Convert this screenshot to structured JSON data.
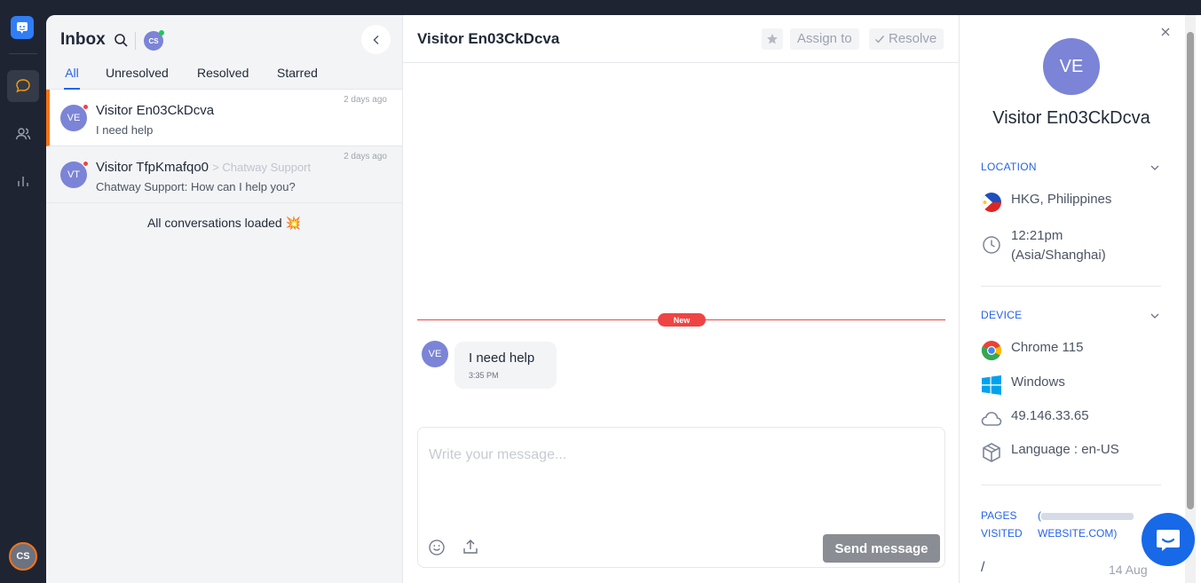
{
  "rail": {
    "user_initials": "CS"
  },
  "inbox": {
    "title": "Inbox",
    "agent_initials": "CS",
    "tabs": [
      {
        "label": "All"
      },
      {
        "label": "Unresolved"
      },
      {
        "label": "Resolved"
      },
      {
        "label": "Starred"
      }
    ],
    "conversations": [
      {
        "initials": "VE",
        "name": "Visitor En03CkDcva",
        "via": "",
        "preview": "I need help",
        "time": "2 days ago"
      },
      {
        "initials": "VT",
        "name": "Visitor TfpKmafqo0",
        "via": "> Chatway Support",
        "preview": "Chatway Support: How can I help you?",
        "time": "2 days ago"
      }
    ],
    "loaded_text": "All conversations loaded 💥"
  },
  "chat": {
    "title": "Visitor En03CkDcva",
    "assign_label": "Assign to",
    "resolve_label": "Resolve",
    "new_badge": "New",
    "message": {
      "initials": "VE",
      "text": "I need help",
      "time": "3:35 PM"
    },
    "composer_placeholder": "Write your message...",
    "send_label": "Send message"
  },
  "info": {
    "initials": "VE",
    "name": "Visitor En03CkDcva",
    "location_title": "LOCATION",
    "location": "HKG, Philippines",
    "local_time": "12:21pm",
    "timezone": "(Asia/Shanghai)",
    "device_title": "DEVICE",
    "browser": "Chrome 115",
    "os": "Windows",
    "ip": "49.146.33.65",
    "language": "Language : en-US",
    "pages_title_1": "PAGES",
    "pages_title_2": "VISITED",
    "pages_url_prefix": "(",
    "pages_url_suffix": "WEBSITE.COM)",
    "page_path": "/",
    "page_date": "14 Aug"
  },
  "colors": {
    "accent": "#2563eb",
    "selected_bar": "#f97316",
    "avatar": "#7b84d6",
    "new_badge": "#ef4444"
  }
}
